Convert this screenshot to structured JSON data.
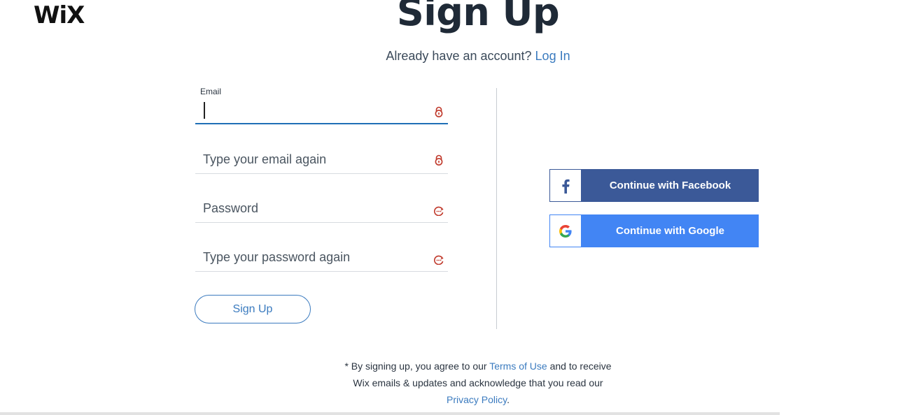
{
  "header": {
    "logo_text": "WiX",
    "title": "Sign Up",
    "subtitle_text": "Already have an account? ",
    "login_link": "Log In"
  },
  "form": {
    "email": {
      "label": "Email",
      "value": "",
      "icon": "password-manager-lock-icon"
    },
    "email_confirm": {
      "placeholder": "Type your email again",
      "icon": "password-manager-lock-icon"
    },
    "password": {
      "placeholder": "Password",
      "icon": "password-manager-key-icon"
    },
    "password_confirm": {
      "placeholder": "Type your password again",
      "icon": "password-manager-key-icon"
    },
    "submit_label": "Sign Up"
  },
  "social": {
    "facebook_label": "Continue with Facebook",
    "google_label": "Continue with Google"
  },
  "terms": {
    "part1": "* By signing up, you agree to our ",
    "terms_link": "Terms of Use",
    "part2": " and to receive Wix emails & updates and acknowledge that you read our ",
    "privacy_link": "Privacy Policy",
    "part3": "."
  },
  "colors": {
    "accent": "#3b7bbf",
    "facebook": "#3b5998",
    "google": "#4285f4",
    "title": "#1f2a37",
    "icon_red": "#c0392b"
  }
}
